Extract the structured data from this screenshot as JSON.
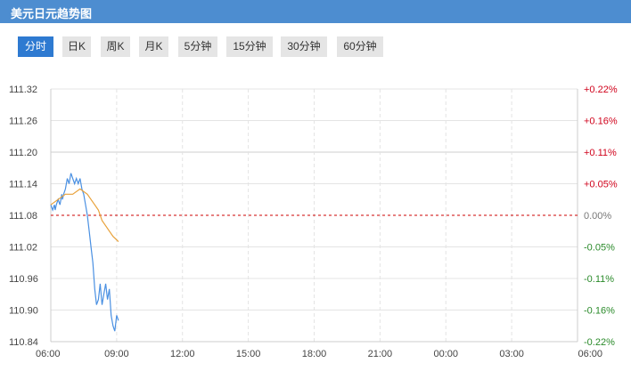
{
  "header": {
    "title": "美元日元趋势图"
  },
  "tabs": [
    {
      "label": "分时",
      "active": true
    },
    {
      "label": "日K",
      "active": false
    },
    {
      "label": "周K",
      "active": false
    },
    {
      "label": "月K",
      "active": false
    },
    {
      "label": "5分钟",
      "active": false
    },
    {
      "label": "15分钟",
      "active": false
    },
    {
      "label": "30分钟",
      "active": false
    },
    {
      "label": "60分钟",
      "active": false
    }
  ],
  "colors": {
    "header_bg": "#4d8dd0",
    "tab_active": "#2e7ad1",
    "price_line": "#4a90e2",
    "avg_line": "#e8a13a",
    "baseline": "#cc0000",
    "up_text": "#d0021b",
    "down_text": "#2a8a2a",
    "neutral_text": "#777777"
  },
  "chart_data": {
    "type": "line",
    "base_price": 111.08,
    "ylim": [
      110.84,
      111.32
    ],
    "y_ticks": [
      "111.32",
      "111.26",
      "111.20",
      "111.14",
      "111.08",
      "111.02",
      "110.96",
      "110.90",
      "110.84"
    ],
    "y_tick_values": [
      111.32,
      111.26,
      111.2,
      111.14,
      111.08,
      111.02,
      110.96,
      110.9,
      110.84
    ],
    "pct_ticks": [
      "+0.22%",
      "+0.16%",
      "+0.11%",
      "+0.05%",
      "0.00%",
      "-0.05%",
      "-0.11%",
      "-0.16%",
      "-0.22%"
    ],
    "pct_directions": [
      "up",
      "up",
      "up",
      "up",
      "flat",
      "down",
      "down",
      "down",
      "down"
    ],
    "x_ticks": [
      "06:00",
      "09:00",
      "12:00",
      "15:00",
      "18:00",
      "21:00",
      "00:00",
      "03:00",
      "06:00"
    ],
    "x_tick_minutes": [
      0,
      180,
      360,
      540,
      720,
      900,
      1080,
      1260,
      1440
    ],
    "xlim_minutes": [
      0,
      1440
    ],
    "grid": true,
    "series": [
      {
        "x_minutes": [
          0,
          5,
          10,
          12,
          15,
          20,
          25,
          30,
          32,
          35,
          40,
          45,
          50,
          55,
          60,
          65,
          70,
          75,
          80,
          85,
          90,
          95,
          100,
          105,
          110,
          115,
          120,
          125,
          130,
          135,
          140,
          145,
          150,
          155,
          160,
          165,
          170,
          175,
          180,
          185
        ],
        "values": [
          111.1,
          111.09,
          111.1,
          111.09,
          111.1,
          111.11,
          111.1,
          111.12,
          111.11,
          111.12,
          111.13,
          111.15,
          111.14,
          111.16,
          111.15,
          111.14,
          111.15,
          111.14,
          111.15,
          111.13,
          111.12,
          111.1,
          111.08,
          111.05,
          111.02,
          110.99,
          110.94,
          110.91,
          110.92,
          110.95,
          110.91,
          110.93,
          110.95,
          110.92,
          110.94,
          110.89,
          110.87,
          110.86,
          110.89,
          110.88
        ]
      },
      {
        "x_minutes": [
          0,
          20,
          40,
          60,
          80,
          100,
          110,
          120,
          130,
          140,
          150,
          160,
          170,
          185
        ],
        "values": [
          111.1,
          111.11,
          111.12,
          111.12,
          111.13,
          111.12,
          111.11,
          111.1,
          111.09,
          111.07,
          111.06,
          111.05,
          111.04,
          111.03
        ]
      }
    ]
  }
}
